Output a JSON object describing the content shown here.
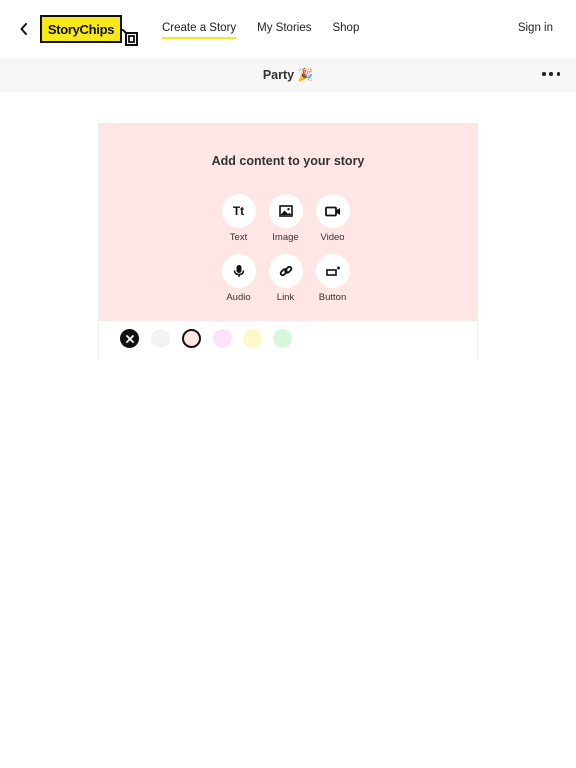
{
  "header": {
    "logo_text": "StoryChips",
    "nav": [
      "Create a Story",
      "My Stories",
      "Shop"
    ],
    "signin_label": "Sign in"
  },
  "story": {
    "title": "Party",
    "title_emoji": "🎉"
  },
  "editor": {
    "heading": "Add content to your story",
    "tools": [
      {
        "label": "Text",
        "icon": "text-icon"
      },
      {
        "label": "Image",
        "icon": "image-icon"
      },
      {
        "label": "Video",
        "icon": "video-icon"
      },
      {
        "label": "Audio",
        "icon": "microphone-icon"
      },
      {
        "label": "Link",
        "icon": "link-icon"
      },
      {
        "label": "Button",
        "icon": "button-icon"
      }
    ],
    "text_icon_glyph": "Tt"
  },
  "swatches": {
    "colors": [
      "#f3f3f3",
      "#ffe6e6",
      "#fde2fb",
      "#fdf8c7",
      "#d6f7dc"
    ],
    "selected_index": 1
  },
  "colors": {
    "accent": "#f8e71c",
    "panel_background": "#ffe6e6"
  }
}
